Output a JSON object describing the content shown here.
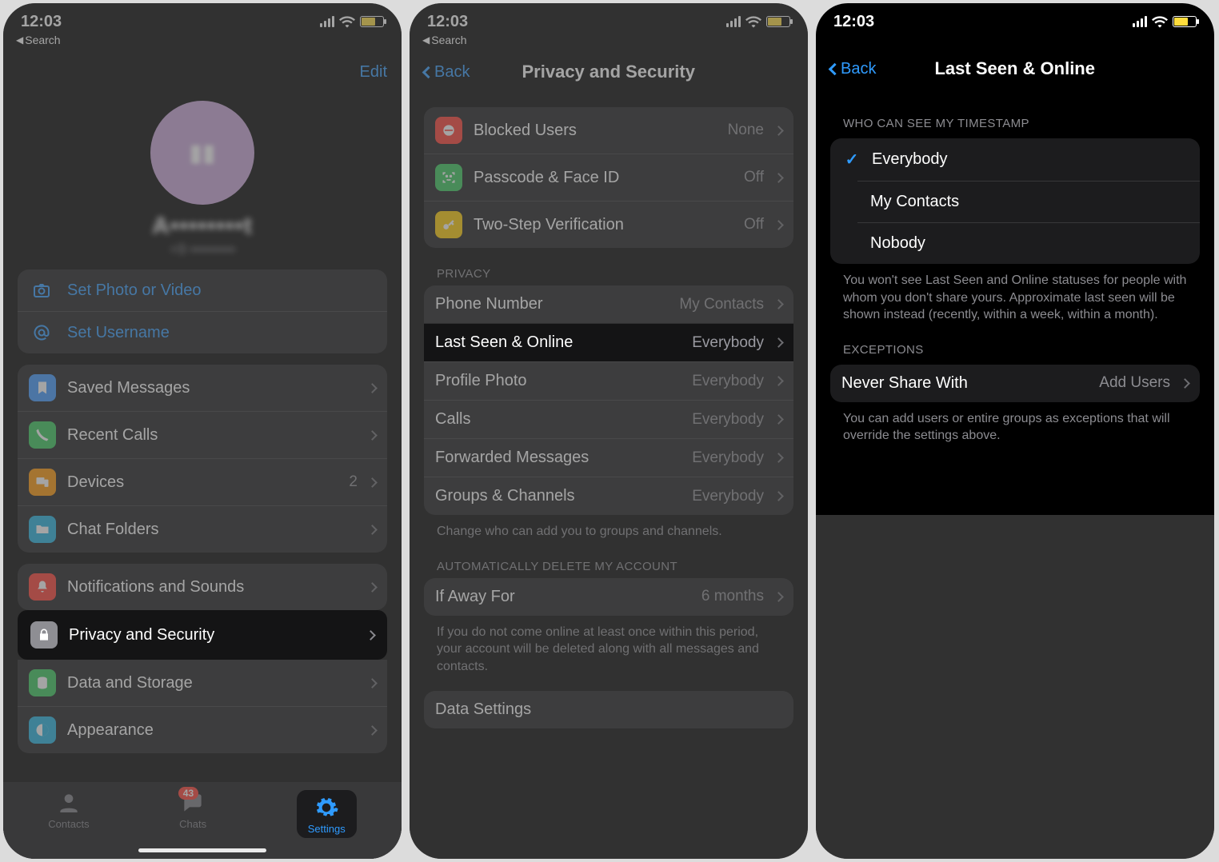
{
  "status": {
    "time": "12:03",
    "breadcrumb": "Search"
  },
  "screen1": {
    "edit": "Edit",
    "profile": {
      "name": "A••••••••t",
      "phone": "+9 •••••••••"
    },
    "actions": {
      "set_photo": "Set Photo or Video",
      "set_username": "Set Username"
    },
    "groupA": {
      "saved": "Saved Messages",
      "recent": "Recent Calls",
      "devices": "Devices",
      "devices_value": "2",
      "folders": "Chat Folders"
    },
    "groupB": {
      "notifications": "Notifications and Sounds",
      "privacy": "Privacy and Security",
      "data": "Data and Storage",
      "appearance": "Appearance"
    },
    "tabs": {
      "contacts": "Contacts",
      "chats": "Chats",
      "chats_badge": "43",
      "settings": "Settings"
    }
  },
  "screen2": {
    "back": "Back",
    "title": "Privacy and Security",
    "top": {
      "blocked": "Blocked Users",
      "blocked_value": "None",
      "passcode": "Passcode & Face ID",
      "passcode_value": "Off",
      "twostep": "Two-Step Verification",
      "twostep_value": "Off"
    },
    "privacy_header": "PRIVACY",
    "privacy": {
      "phone": "Phone Number",
      "phone_value": "My Contacts",
      "lastseen": "Last Seen & Online",
      "lastseen_value": "Everybody",
      "profilephoto": "Profile Photo",
      "profilephoto_value": "Everybody",
      "calls": "Calls",
      "calls_value": "Everybody",
      "forwarded": "Forwarded Messages",
      "forwarded_value": "Everybody",
      "groups": "Groups & Channels",
      "groups_value": "Everybody"
    },
    "privacy_footer": "Change who can add you to groups and channels.",
    "delete_header": "AUTOMATICALLY DELETE MY ACCOUNT",
    "delete": {
      "ifaway": "If Away For",
      "ifaway_value": "6 months"
    },
    "delete_footer": "If you do not come online at least once within this period, your account will be deleted along with all messages and contacts.",
    "datasettings": "Data Settings"
  },
  "screen3": {
    "back": "Back",
    "title": "Last Seen & Online",
    "timestamp_header": "WHO CAN SEE MY TIMESTAMP",
    "options": {
      "everybody": "Everybody",
      "mycontacts": "My Contacts",
      "nobody": "Nobody"
    },
    "timestamp_footer": "You won't see Last Seen and Online statuses for people with whom you don't share yours. Approximate last seen will be shown instead (recently, within a week, within a month).",
    "exceptions_header": "EXCEPTIONS",
    "exceptions_row": {
      "label": "Never Share With",
      "value": "Add Users"
    },
    "exceptions_footer": "You can add users or entire groups as exceptions that will override the settings above."
  }
}
